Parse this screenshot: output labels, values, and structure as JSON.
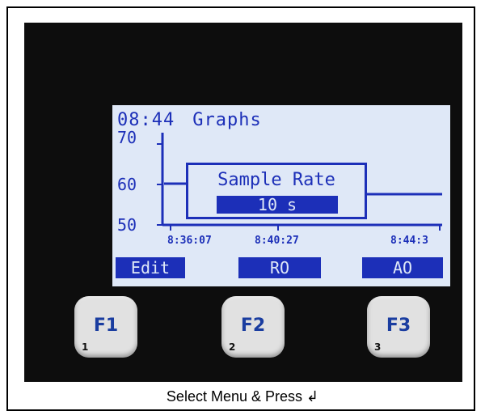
{
  "screen": {
    "time": "08:44",
    "title": "Graphs",
    "y_ticks": [
      "70",
      "60",
      "50"
    ],
    "x_ticks": [
      "8:36:07",
      "8:40:27",
      "8:44:3"
    ]
  },
  "dialog": {
    "title": "Sample Rate",
    "value": "10 s"
  },
  "softkeys": {
    "left": "Edit",
    "middle": "RO",
    "right": "AO"
  },
  "keys": [
    {
      "label": "F1",
      "num": "1"
    },
    {
      "label": "F2",
      "num": "2"
    },
    {
      "label": "F3",
      "num": "3"
    }
  ],
  "caption": "Select Menu & Press ↲",
  "colors": {
    "lcd_background": "#dfe8f7",
    "lcd_foreground": "#1c2fb8",
    "device_body": "#0d0d0d",
    "key_face": "#e1e1e1",
    "key_label": "#1a3da0"
  }
}
